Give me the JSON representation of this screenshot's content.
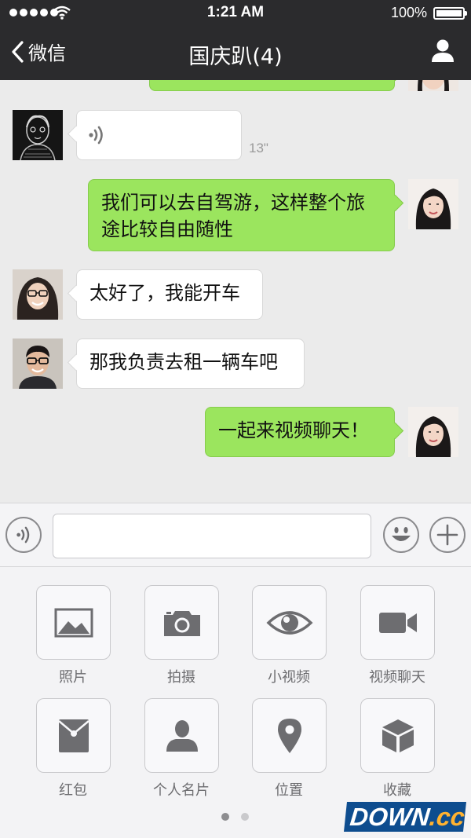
{
  "status_bar": {
    "time": "1:21 AM",
    "battery": "100%"
  },
  "nav": {
    "back_label": "微信",
    "title": "国庆趴(4)"
  },
  "messages": [
    {
      "side": "left",
      "type": "voice",
      "duration": "13\""
    },
    {
      "side": "right",
      "type": "text",
      "lines": [
        "我们可以去自驾游，这样整个旅",
        "途比较自由随性"
      ]
    },
    {
      "side": "left",
      "type": "text",
      "text": "太好了，我能开车"
    },
    {
      "side": "left",
      "type": "text",
      "text": "那我负责去租一辆车吧"
    },
    {
      "side": "right",
      "type": "text",
      "text": "一起来视频聊天！"
    }
  ],
  "panel": {
    "items": [
      {
        "label": "照片",
        "icon": "photo-icon"
      },
      {
        "label": "拍摄",
        "icon": "camera-icon"
      },
      {
        "label": "小视频",
        "icon": "eye-icon"
      },
      {
        "label": "视频聊天",
        "icon": "video-camera-icon"
      },
      {
        "label": "红包",
        "icon": "red-envelope-icon"
      },
      {
        "label": "个人名片",
        "icon": "person-icon"
      },
      {
        "label": "位置",
        "icon": "location-pin-icon"
      },
      {
        "label": "收藏",
        "icon": "cube-icon"
      }
    ],
    "page_dots": {
      "count": 2,
      "active": 1
    }
  },
  "watermark": {
    "main": "DOWN",
    "suffix": ".cc"
  },
  "colors": {
    "nav_bg": "#2b2b2d",
    "green_bubble": "#9be55e",
    "chat_bg": "#ebebeb"
  }
}
